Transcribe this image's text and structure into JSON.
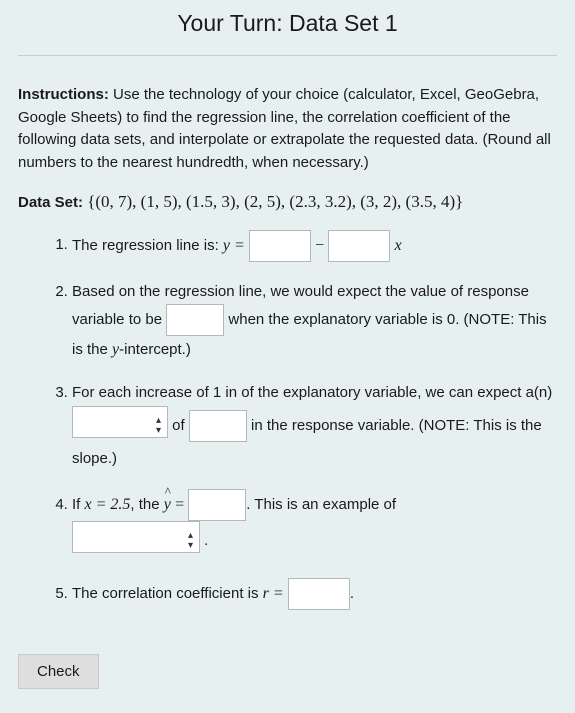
{
  "title": "Your Turn: Data Set 1",
  "instructions_label": "Instructions:",
  "instructions_text": " Use the technology of your choice (calculator, Excel, GeoGebra, Google Sheets) to find the regression line, the correlation coefficient of the following data sets, and interpolate or extrapolate the requested data. (Round all numbers to the nearest hundredth, when necessary.)",
  "dataset_label": "Data Set:",
  "dataset_values": "{(0, 7), (1, 5), (1.5, 3), (2, 5), (2.3, 3.2), (3, 2), (3.5, 4)}",
  "q1": {
    "pre": "The regression line is: ",
    "y_eq": "y =",
    "minus": "−",
    "x": "x"
  },
  "q2": {
    "part1": "Based on the regression line, we would expect the value of response variable to be ",
    "part2": " when the explanatory variable is 0. (NOTE: This is the ",
    "yint": "y",
    "part3": "-intercept.)"
  },
  "q3": {
    "part1": "For each increase of 1 in of the explanatory variable, we can expect a(n) ",
    "of": " of ",
    "part2": " in the response variable. (NOTE: This is the slope.)"
  },
  "q4": {
    "if": "If ",
    "xeq": "x = 2.5",
    "comma": ", the ",
    "eq": " =",
    "part2": ". This is an example of ",
    "dot": "."
  },
  "q5": {
    "pre": "The correlation coefficient is ",
    "r_eq": "r =",
    "dot": "."
  },
  "check_label": "Check"
}
